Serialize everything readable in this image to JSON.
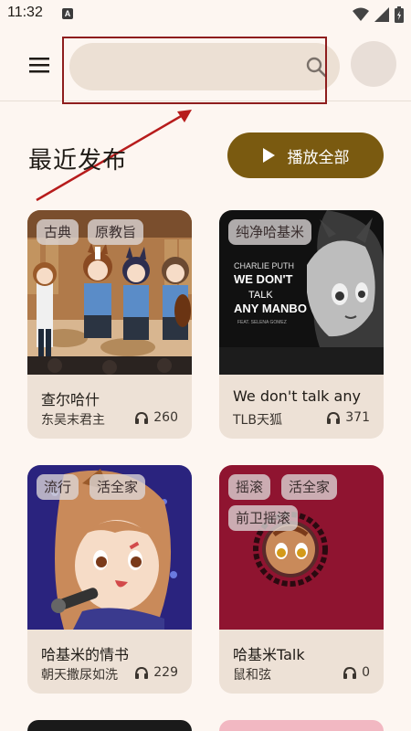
{
  "status_bar": {
    "time": "11:32",
    "notification_icon": "A",
    "icons": [
      "wifi-icon",
      "signal-icon",
      "battery-icon"
    ]
  },
  "search": {
    "value": "",
    "placeholder": ""
  },
  "section": {
    "title": "最近发布",
    "play_all_label": "播放全部"
  },
  "cards": [
    {
      "title": "查尔哈什",
      "author": "东吴末君主",
      "plays": "260",
      "tags": [
        "古典",
        "原教旨"
      ],
      "cover_text": []
    },
    {
      "title": "We don't talk any",
      "author": "TLB天狐",
      "plays": "371",
      "tags": [
        "纯净哈基米"
      ],
      "cover_text": [
        "CHARLIE PUTH",
        "WE DON'T",
        "TALK",
        "ANY MANBO",
        "FEAT. SELENA GOMEZ"
      ]
    },
    {
      "title": "哈基米的情书",
      "author": "朝天撒尿如洗",
      "plays": "229",
      "tags": [
        "流行",
        "活全家"
      ],
      "cover_text": []
    },
    {
      "title": "哈基米Talk",
      "author": "鼠和弦",
      "plays": "0",
      "tags": [
        "摇滚",
        "活全家",
        "前卫摇滚"
      ],
      "cover_text": []
    }
  ],
  "colors": {
    "background": "#fdf6f1",
    "accent": "#7a5a10",
    "card_background": "#ede1d6",
    "highlight_annotation": "#8e1d1d"
  }
}
